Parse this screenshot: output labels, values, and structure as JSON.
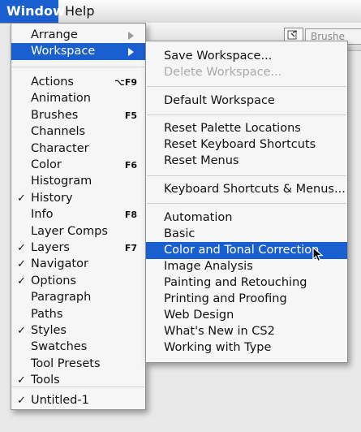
{
  "menubar": {
    "window": "Window",
    "help": "Help"
  },
  "background": {
    "brush_tab": "Brushe"
  },
  "window_menu": {
    "top": [
      {
        "label": "Arrange",
        "arrow": true
      },
      {
        "label": "Workspace",
        "arrow": true,
        "highlighted": true
      }
    ],
    "panels": [
      {
        "label": "Actions",
        "shortcut": "⌥F9",
        "checked": false
      },
      {
        "label": "Animation",
        "shortcut": "",
        "checked": false
      },
      {
        "label": "Brushes",
        "shortcut": "F5",
        "checked": false
      },
      {
        "label": "Channels",
        "shortcut": "",
        "checked": false
      },
      {
        "label": "Character",
        "shortcut": "",
        "checked": false
      },
      {
        "label": "Color",
        "shortcut": "F6",
        "checked": false
      },
      {
        "label": "Histogram",
        "shortcut": "",
        "checked": false
      },
      {
        "label": "History",
        "shortcut": "",
        "checked": true
      },
      {
        "label": "Info",
        "shortcut": "F8",
        "checked": false
      },
      {
        "label": "Layer Comps",
        "shortcut": "",
        "checked": false
      },
      {
        "label": "Layers",
        "shortcut": "F7",
        "checked": true
      },
      {
        "label": "Navigator",
        "shortcut": "",
        "checked": true
      },
      {
        "label": "Options",
        "shortcut": "",
        "checked": true
      },
      {
        "label": "Paragraph",
        "shortcut": "",
        "checked": false
      },
      {
        "label": "Paths",
        "shortcut": "",
        "checked": false
      },
      {
        "label": "Styles",
        "shortcut": "",
        "checked": true
      },
      {
        "label": "Swatches",
        "shortcut": "",
        "checked": false
      },
      {
        "label": "Tool Presets",
        "shortcut": "",
        "checked": false
      },
      {
        "label": "Tools",
        "shortcut": "",
        "checked": true
      }
    ],
    "documents": [
      {
        "label": "Untitled-1",
        "checked": true
      }
    ]
  },
  "workspace_submenu": {
    "save": "Save Workspace...",
    "delete": "Delete Workspace...",
    "default": "Default Workspace",
    "resets": [
      "Reset Palette Locations",
      "Reset Keyboard Shortcuts",
      "Reset Menus"
    ],
    "keyboard": "Keyboard Shortcuts & Menus...",
    "workspaces": [
      "Automation",
      "Basic",
      "Color and Tonal Correction",
      "Image Analysis",
      "Painting and Retouching",
      "Printing and Proofing",
      "Web Design",
      "What's New in CS2",
      "Working with Type"
    ],
    "highlighted": "Color and Tonal Correction"
  },
  "colors": {
    "highlight": "#1a5fd0",
    "menu_bg": "#f6f6f6",
    "disabled": "#a9a9a9"
  }
}
